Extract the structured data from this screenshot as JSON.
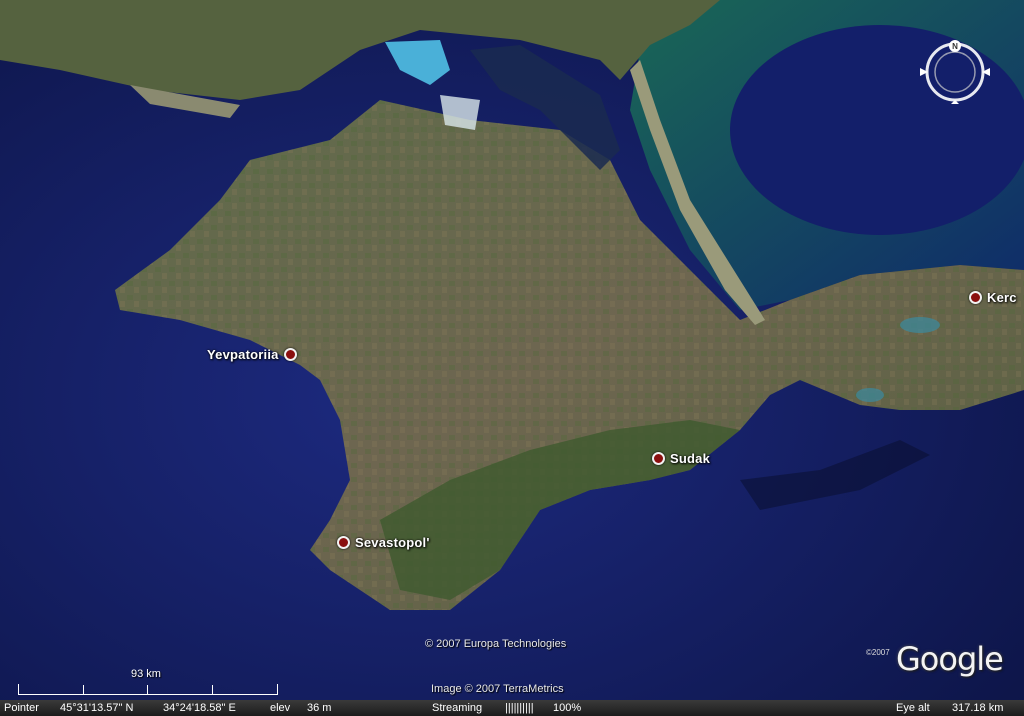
{
  "places": [
    {
      "name": "Yevpatoriia",
      "id": "place-yevpatoriia"
    },
    {
      "name": "Sudak",
      "id": "place-sudak"
    },
    {
      "name": "Sevastopol'",
      "id": "place-sevastopol"
    },
    {
      "name": "Kerc",
      "id": "place-kerch"
    }
  ],
  "credits": {
    "europa": "© 2007 Europa Technologies",
    "terrametrics": "Image © 2007 TerraMetrics"
  },
  "logo": {
    "copyright": "©2007",
    "text": "Google"
  },
  "compass": {
    "north_letter": "N"
  },
  "scale": {
    "label": "93 km"
  },
  "status": {
    "pointer_label": "Pointer",
    "lat": "45°31'13.57\" N",
    "lon": "34°24'18.58\" E",
    "elev_label": "elev",
    "elev_value": "36 m",
    "streaming_label": "Streaming",
    "streaming_bar": "||||||||||",
    "streaming_pct": "100%",
    "eye_alt_label": "Eye alt",
    "eye_alt_value": "317.18 km"
  },
  "colors": {
    "sea_deep": "#14206a",
    "sea_shallow": "#1f6d5a",
    "land": "#6b6a4e",
    "marker": "#8a0f0f"
  }
}
